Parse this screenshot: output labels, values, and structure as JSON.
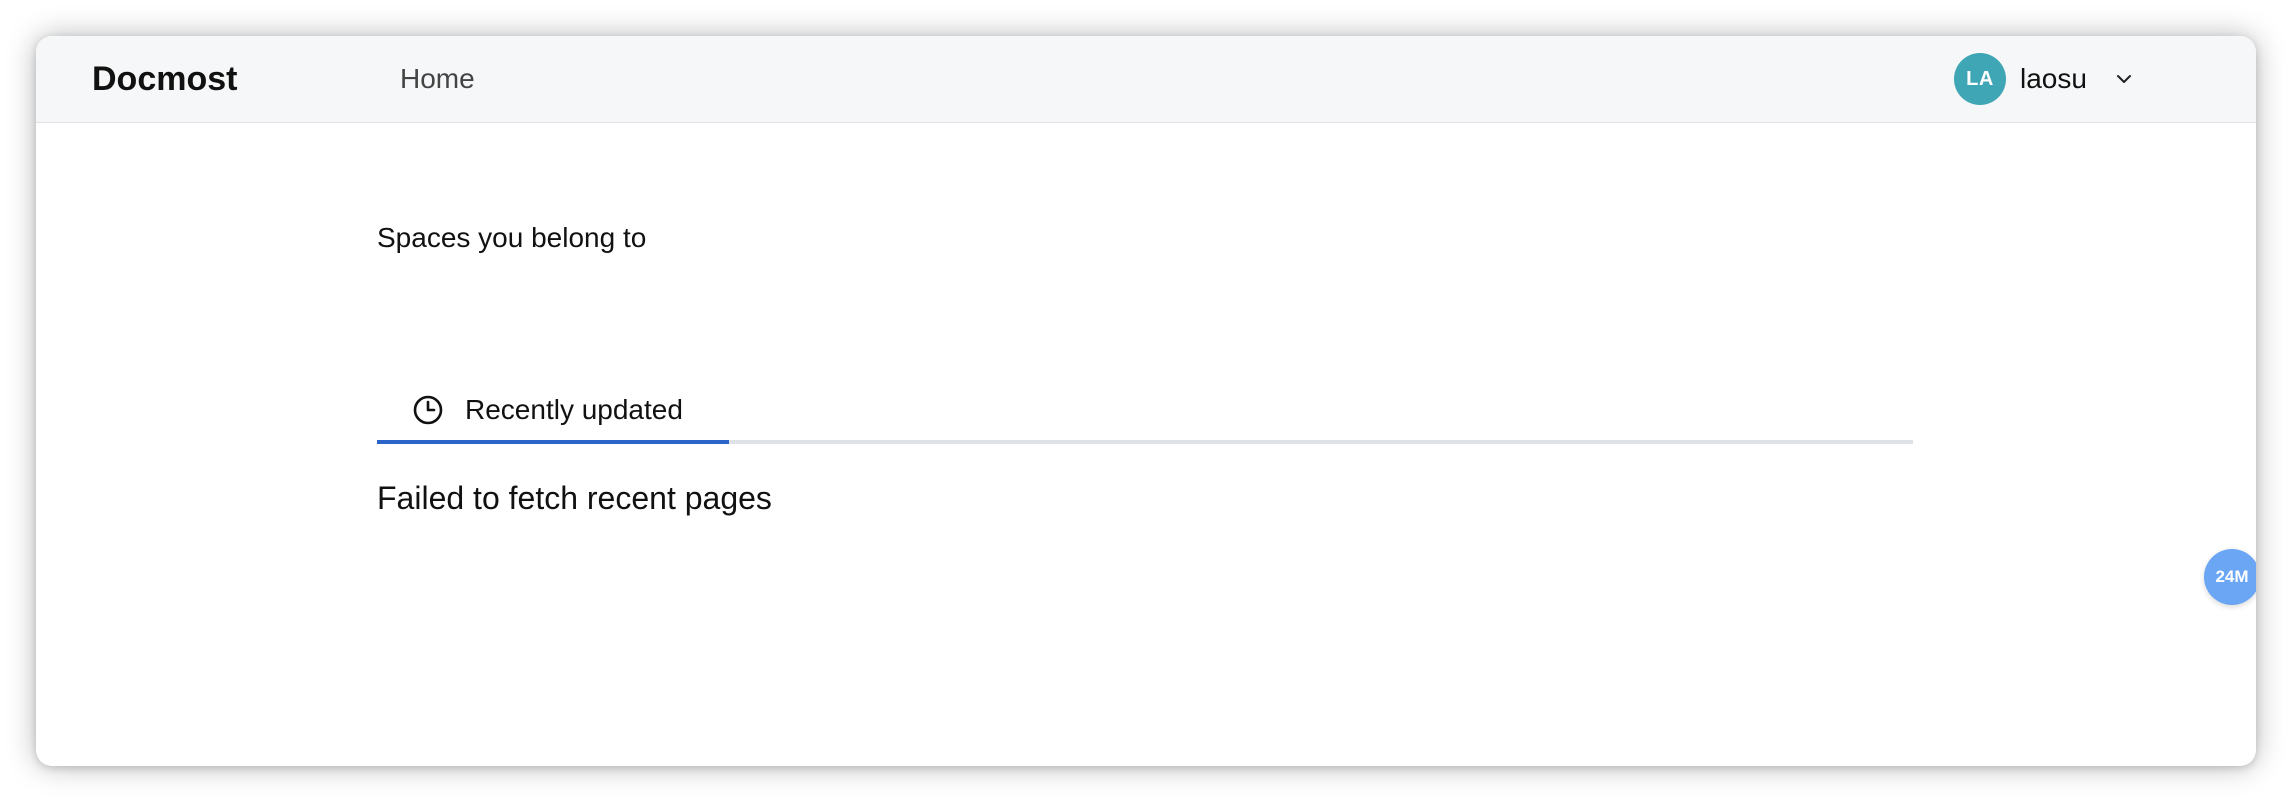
{
  "header": {
    "logo": "Docmost",
    "nav": {
      "home_label": "Home"
    },
    "user": {
      "initials": "LA",
      "name": "laosu",
      "avatar_color": "#3fa6b6"
    }
  },
  "main": {
    "spaces_title": "Spaces you belong to",
    "tabs": [
      {
        "label": "Recently updated",
        "icon": "clock-icon",
        "active": true
      }
    ],
    "error_message": "Failed to fetch recent pages"
  },
  "floating_badge": {
    "label": "24M",
    "color": "#6aa6f4"
  },
  "colors": {
    "accent": "#2b63c7",
    "header_bg": "#f6f7f8"
  }
}
